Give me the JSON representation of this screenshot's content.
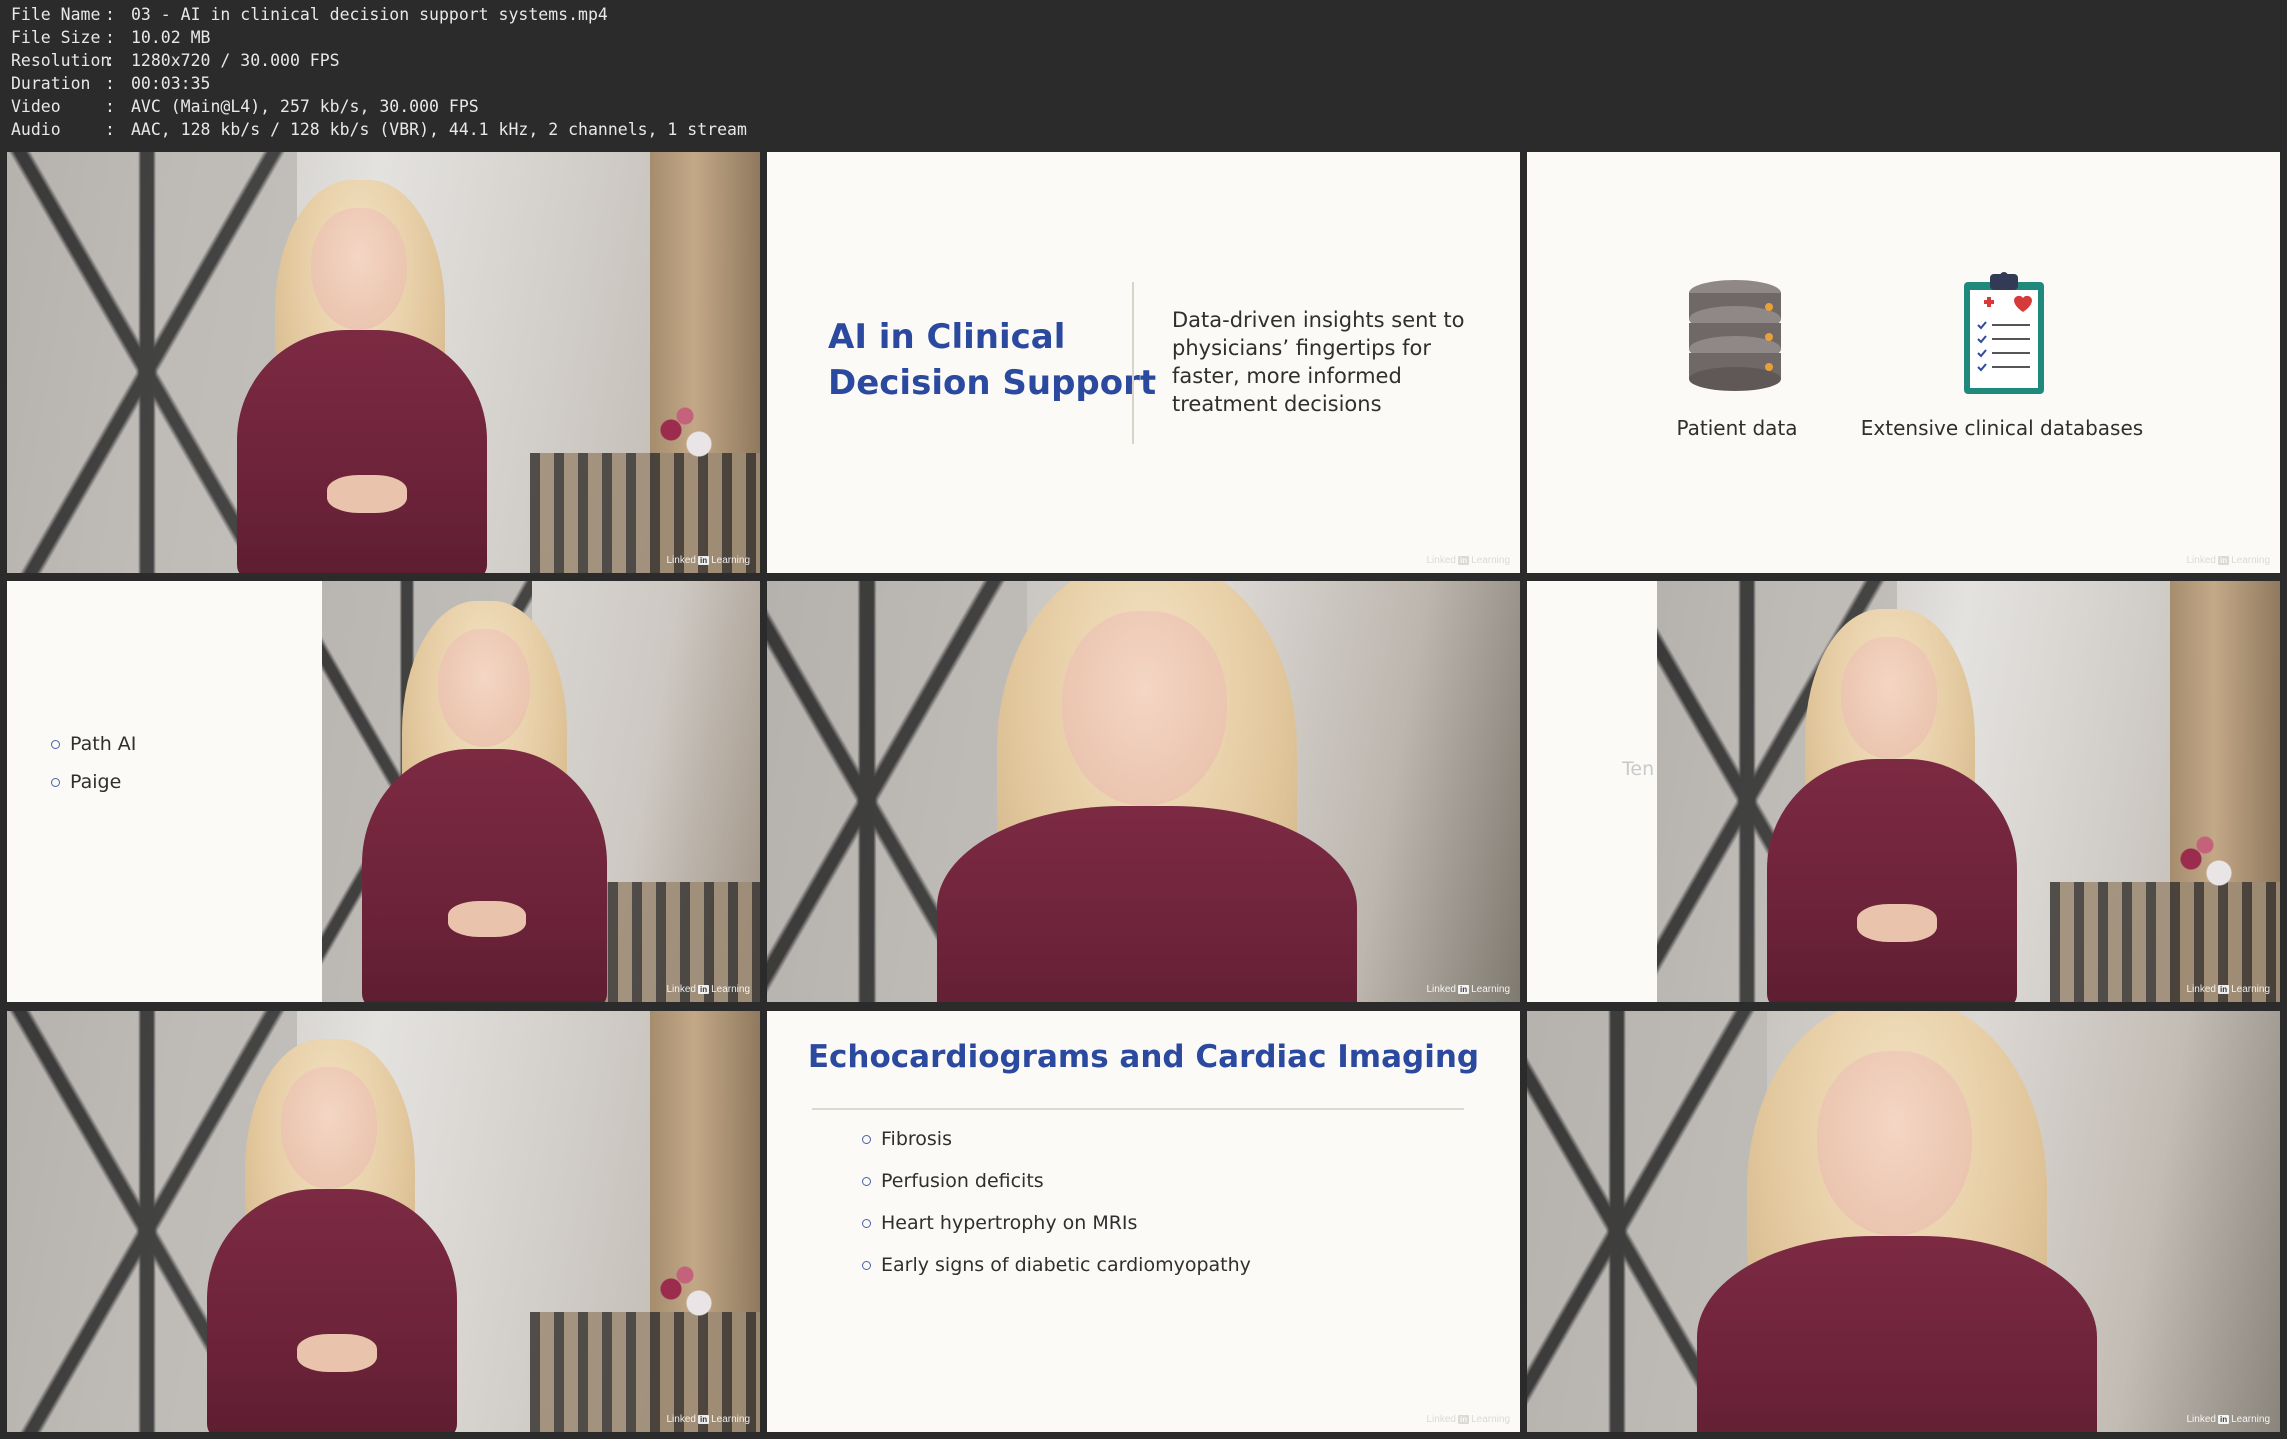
{
  "file_info": [
    {
      "label": "File Name",
      "value": "03 - AI in clinical decision support systems.mp4"
    },
    {
      "label": "File Size",
      "value": "10.02 MB"
    },
    {
      "label": "Resolution",
      "value": "1280x720 / 30.000 FPS"
    },
    {
      "label": "Duration",
      "value": "00:03:35"
    },
    {
      "label": "Video",
      "value": "AVC (Main@L4), 257 kb/s, 30.000 FPS"
    },
    {
      "label": "Audio",
      "value": "AAC, 128 kb/s / 128 kb/s (VBR), 44.1 kHz, 2 channels, 1 stream"
    }
  ],
  "separator": ":",
  "watermark": {
    "brand": "Linked",
    "in": "in",
    "suffix": "Learning"
  },
  "frame2": {
    "title_line1": "AI in Clinical",
    "title_line2": "Decision Support",
    "body_lines": [
      "Data-driven insights sent to",
      "physicians’ fingertips for",
      "faster, more informed",
      "treatment decisions"
    ]
  },
  "frame3": {
    "icon1_label": "Patient data",
    "icon2_label": "Extensive clinical databases"
  },
  "frame4": {
    "bullets": [
      "Path AI",
      "Paige"
    ]
  },
  "frame6": {
    "partial_text": "Ten"
  },
  "frame8": {
    "title": "Echocardiograms and Cardiac Imaging",
    "bullets": [
      "Fibrosis",
      "Perfusion deficits",
      "Heart hypertrophy on MRIs",
      "Early signs of diabetic cardiomyopathy"
    ]
  },
  "colors": {
    "slide_title": "#2b4a9f",
    "dress": "#6a2238",
    "slide_bg": "#fbfaf7",
    "background": "#2b2b2b"
  }
}
